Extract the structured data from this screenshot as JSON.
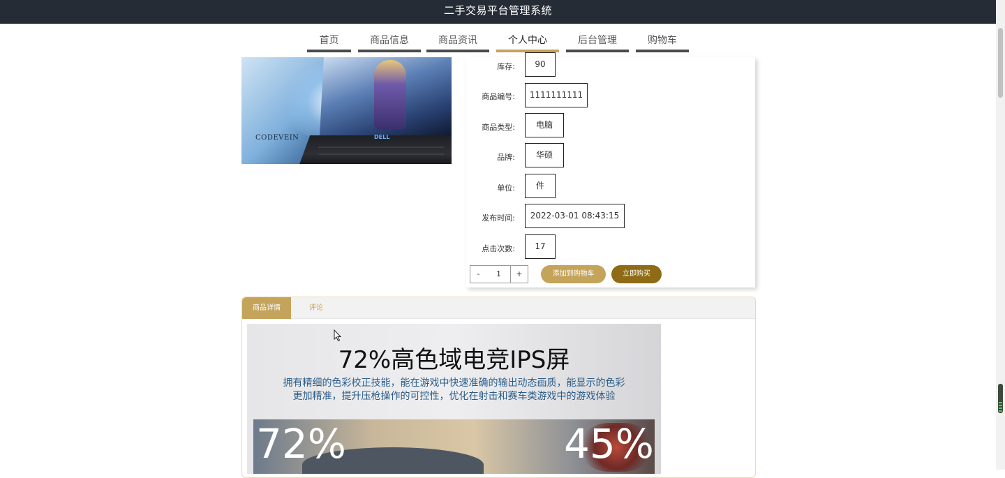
{
  "app": {
    "title": "二手交易平台管理系统"
  },
  "nav": {
    "items": [
      {
        "label": "首页"
      },
      {
        "label": "商品信息"
      },
      {
        "label": "商品资讯"
      },
      {
        "label": "个人中心",
        "active": true
      },
      {
        "label": "后台管理"
      },
      {
        "label": "购物车"
      }
    ]
  },
  "product_image": {
    "brand_text": "CODEVEIN",
    "logo_text": "DELL"
  },
  "product": {
    "fields": [
      {
        "label": "库存:",
        "value": "90"
      },
      {
        "label": "商品编号:",
        "value": "1111111111"
      },
      {
        "label": "商品类型:",
        "value": "电脑"
      },
      {
        "label": "品牌:",
        "value": "华硕"
      },
      {
        "label": "单位:",
        "value": "件"
      },
      {
        "label": "发布时间:",
        "value": "2022-03-01 08:43:15"
      },
      {
        "label": "点击次数:",
        "value": "17"
      }
    ]
  },
  "quantity": {
    "minus": "-",
    "value": "1",
    "plus": "+"
  },
  "actions": {
    "add_to_cart": "添加到购物车",
    "buy_now": "立即购买"
  },
  "tabs": [
    {
      "label": "商品详情",
      "active": true
    },
    {
      "label": "评论"
    }
  ],
  "detail": {
    "title": "72%高色域电竞IPS屏",
    "subtitle_line1": "拥有精细的色彩校正技能，能在游戏中快速准确的输出动态画质，能显示的色彩",
    "subtitle_line2": "更加精准，提升压枪操作的可控性，优化在射击和赛车类游戏中的游戏体验",
    "stat_left": "72%",
    "stat_right": "45%"
  },
  "colors": {
    "accent": "#c4a35a",
    "buy": "#8e6b14",
    "header": "#262c36"
  }
}
